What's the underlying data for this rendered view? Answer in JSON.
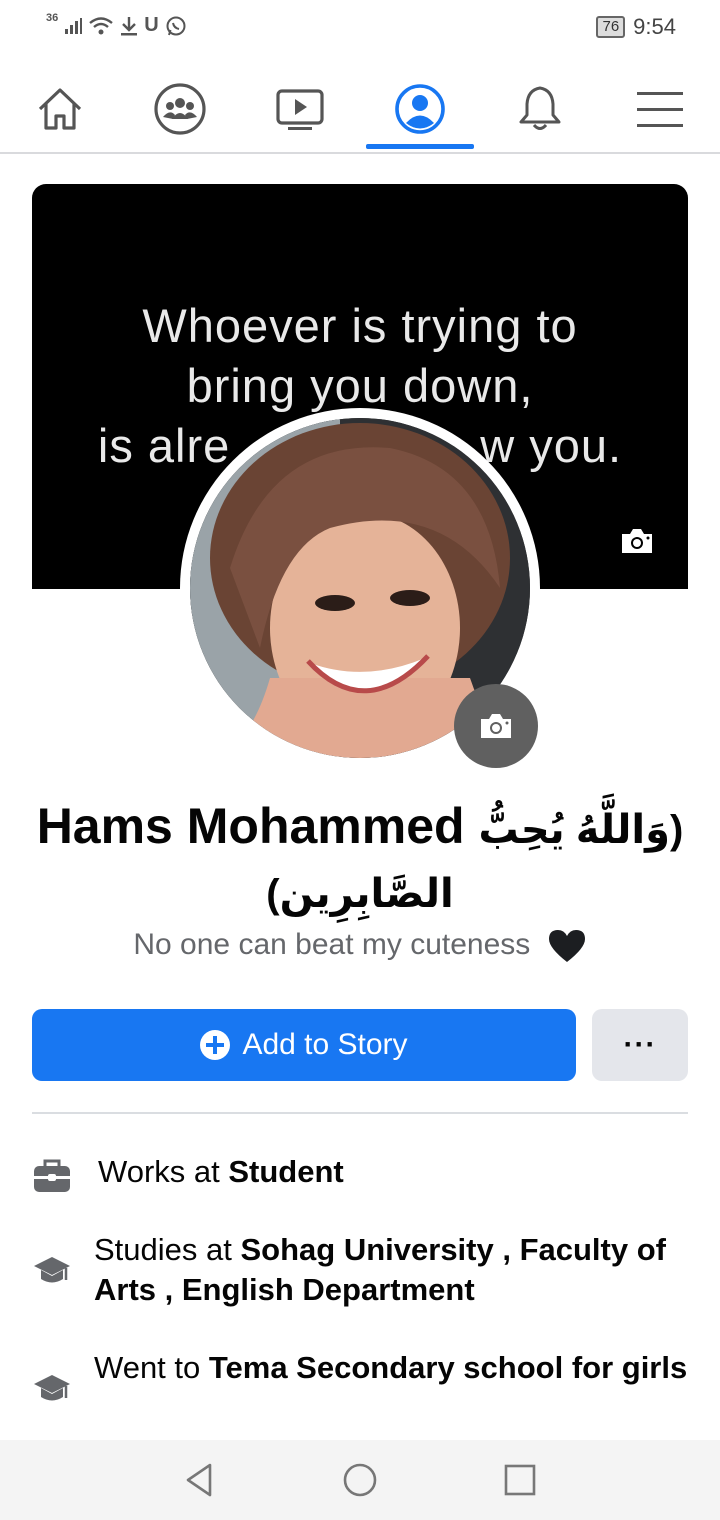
{
  "status_bar": {
    "network": "36",
    "icons": [
      "signal-icon",
      "wifi-icon",
      "download-icon",
      "u-icon",
      "whatsapp-icon"
    ],
    "battery": "76",
    "time": "9:54"
  },
  "top_nav": {
    "items": [
      "home-icon",
      "groups-icon",
      "watch-icon",
      "profile-icon",
      "notifications-icon",
      "menu-icon"
    ],
    "active_index": 3,
    "accent_color": "#1877f2"
  },
  "cover": {
    "quote_line1": "Whoever is trying to",
    "quote_line2": "bring you down,",
    "quote_line3": "is alre",
    "quote_line3_end": "w you."
  },
  "profile": {
    "name_en": "Hams Mohammed",
    "name_ar_part1": "(وَاللَّهُ يُحِبُّ",
    "name_ar_part2": "الصَّابِرِين)",
    "bio": "No one can beat my cuteness"
  },
  "actions": {
    "add_story": "Add to Story",
    "more": "···"
  },
  "details": [
    {
      "prefix": "Works at",
      "strong": "Student",
      "icon": "briefcase-icon"
    },
    {
      "prefix": "Studies at",
      "strong": "Sohag University , Faculty of Arts , English Department",
      "icon": "graduation-cap-icon"
    },
    {
      "prefix": "Went to",
      "strong": "Tema Secondary school for girls",
      "icon": "graduation-cap-icon"
    }
  ]
}
